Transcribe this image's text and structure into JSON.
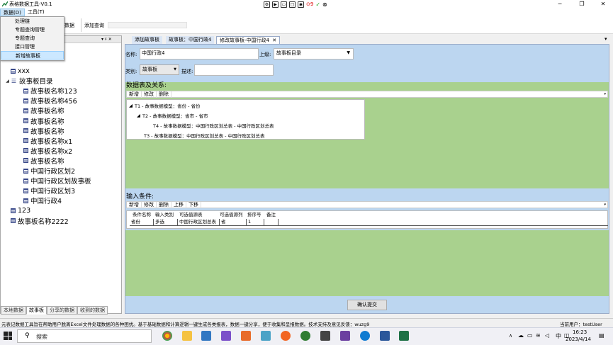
{
  "window": {
    "title": "表格数据工具-V0.1",
    "control_indicator": "9"
  },
  "menu": {
    "items": [
      "数据(D)",
      "工具(T)"
    ],
    "dropdown": [
      "处理链",
      "专题查询管理",
      "专题查询",
      "接口管理",
      "新增故事板"
    ]
  },
  "ribbon": {
    "partial_label": "数据",
    "add_query": "添加查询"
  },
  "left_panel": {
    "pin_label": "▾ ♯ ✕",
    "tree": [
      {
        "label": "xxx",
        "level": 1,
        "icon": "table"
      },
      {
        "label": "故事板目录",
        "level": 1,
        "icon": "list",
        "expanded": true
      },
      {
        "label": "故事板名称123",
        "level": 2,
        "icon": "table"
      },
      {
        "label": "故事板名称456",
        "level": 2,
        "icon": "table"
      },
      {
        "label": "故事板名称",
        "level": 2,
        "icon": "table"
      },
      {
        "label": "故事板名称",
        "level": 2,
        "icon": "table"
      },
      {
        "label": "故事板名称",
        "level": 2,
        "icon": "table"
      },
      {
        "label": "故事板名称x1",
        "level": 2,
        "icon": "table"
      },
      {
        "label": "故事板名称x2",
        "level": 2,
        "icon": "table"
      },
      {
        "label": "故事板名称",
        "level": 2,
        "icon": "table"
      },
      {
        "label": "中国行政区划2",
        "level": 2,
        "icon": "table"
      },
      {
        "label": "中国行政区划故事板",
        "level": 2,
        "icon": "table"
      },
      {
        "label": "中国行政区划3",
        "level": 2,
        "icon": "table"
      },
      {
        "label": "中国行政4",
        "level": 2,
        "icon": "table"
      },
      {
        "label": "123",
        "level": 1,
        "icon": "table"
      },
      {
        "label": "故事板名称2222",
        "level": 1,
        "icon": "table"
      }
    ],
    "bottom_tabs": [
      "本地数据",
      "故事板",
      "分享的数据",
      "收到的数据"
    ]
  },
  "doc_tabs": {
    "tabs": [
      "添加故事板",
      "故事板：中国行政4",
      "修改故事板-中国行政4"
    ],
    "active_close": "✕",
    "overflow_icon": "▾"
  },
  "form": {
    "name_label": "名称:",
    "name_value": "中国行政4",
    "parent_label": "上级:",
    "parent_value": "故事板目录",
    "category_label": "类别:",
    "category_value": "故事板",
    "desc_label": "描述:",
    "desc_value": ""
  },
  "relations": {
    "title": "数据表及关系:",
    "toolbar": [
      "新增",
      "修改",
      "删除"
    ],
    "rows": [
      "T1 - 故事数据模型：省份 - 省份",
      "T2 - 故事数据模型：省市 - 省市",
      "T4 - 故事数据模型：中国行政区划总表 - 中国行政区划总表",
      "T3 - 故事数据模型：中国行政区划总表 - 中国行政区划总表"
    ]
  },
  "conditions": {
    "title": "输入条件:",
    "toolbar": [
      "新增",
      "修改",
      "删除",
      "上移",
      "下移"
    ],
    "headers": [
      "条件名称",
      "输入类别",
      "可选值源表",
      "可选值源列",
      "排序号",
      "备注"
    ],
    "rows": [
      [
        "省份",
        "多选",
        "中国行政区划总表",
        "省",
        "1",
        ""
      ]
    ]
  },
  "submit_label": "确认提交",
  "statusbar": {
    "message": "元表记数据工具旨在帮助用户脱离Excel文件处理数据的各种困扰。基于基础数据和计算逻辑一键生成各类报表，数据一键分享，便于收集和呈报数据。技术支持及意见反馈：wuzg9",
    "user": "当前用户：testUser"
  },
  "taskbar": {
    "search_placeholder": "搜索",
    "time": "16:23",
    "date": "2023/4/14",
    "ime": "中"
  },
  "colors": {
    "doc_bg": "#bcd6f0",
    "green_band": "#a9d18e",
    "menu_highlight": "#cce8ff"
  }
}
